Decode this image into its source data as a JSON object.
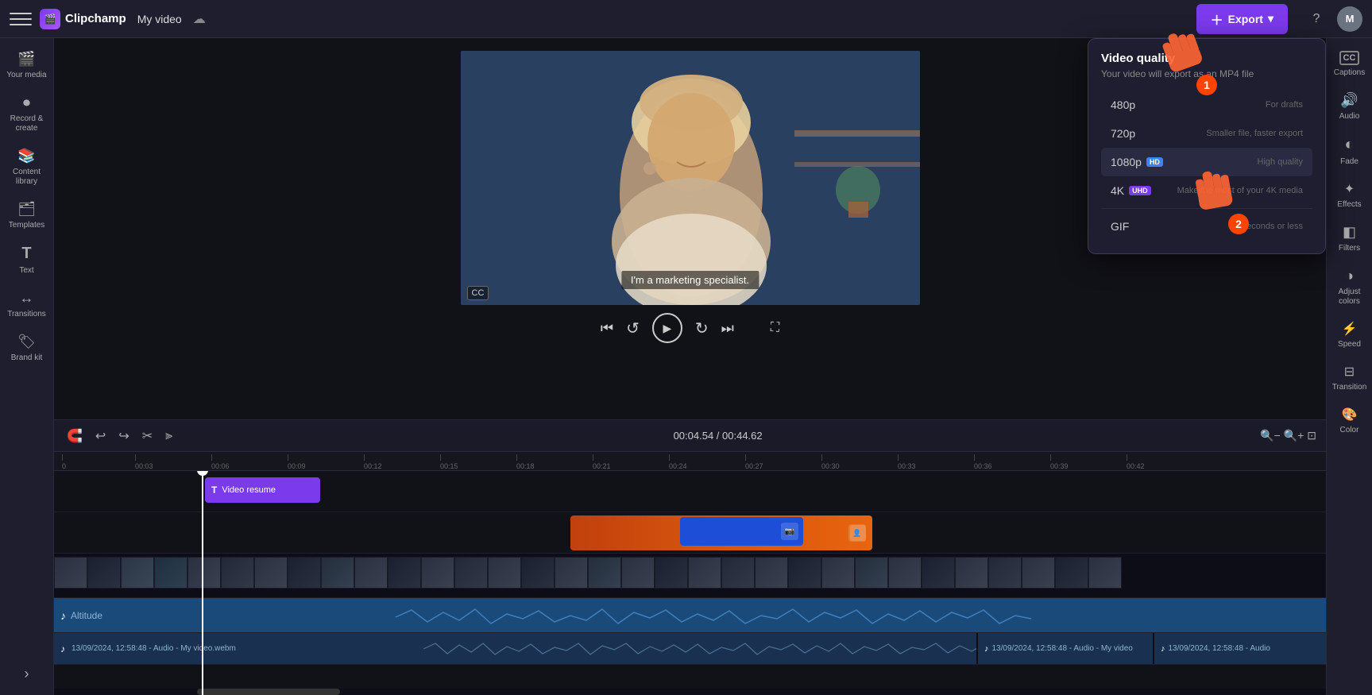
{
  "app": {
    "name": "Clipchamp",
    "title": "My video",
    "logo_char": "C"
  },
  "topbar": {
    "hamburger_label": "Menu",
    "export_label": "Export",
    "export_dropdown_label": "▼",
    "help_label": "?",
    "avatar_initials": "M"
  },
  "left_sidebar": {
    "items": [
      {
        "id": "your-media",
        "icon": "🎬",
        "label": "Your media"
      },
      {
        "id": "record",
        "icon": "⏺",
        "label": "Record & create"
      },
      {
        "id": "content-library",
        "icon": "📚",
        "label": "Content library"
      },
      {
        "id": "templates",
        "icon": "🗂",
        "label": "Templates"
      },
      {
        "id": "text",
        "icon": "T",
        "label": "Text"
      },
      {
        "id": "transitions",
        "icon": "↔",
        "label": "Transitions"
      },
      {
        "id": "brand-kit",
        "icon": "🏷",
        "label": "Brand kit"
      }
    ],
    "expand_arrow": "›"
  },
  "right_sidebar": {
    "items": [
      {
        "id": "captions",
        "icon": "CC",
        "label": "Captions"
      },
      {
        "id": "audio",
        "icon": "🔊",
        "label": "Audio"
      },
      {
        "id": "fade",
        "icon": "◐",
        "label": "Fade"
      },
      {
        "id": "effects",
        "icon": "✦",
        "label": "Effects"
      },
      {
        "id": "filters",
        "icon": "◧",
        "label": "Filters"
      },
      {
        "id": "adjust-colors",
        "icon": "◑",
        "label": "Adjust colors"
      },
      {
        "id": "speed",
        "icon": "⚡",
        "label": "Speed"
      },
      {
        "id": "transition",
        "icon": "⊡",
        "label": "Transition"
      },
      {
        "id": "color",
        "icon": "🎨",
        "label": "Color"
      }
    ]
  },
  "video_preview": {
    "subtitle": "I'm a marketing specialist.",
    "timecode": "00:04.54 / 00:44.62",
    "cc_label": "CC"
  },
  "playback_controls": {
    "skip_back": "⏮",
    "rewind": "↺",
    "play": "▶",
    "forward": "↻",
    "skip_fwd": "⏭",
    "fullscreen": "⛶"
  },
  "timeline": {
    "toolbar": {
      "magnet_icon": "🧲",
      "undo": "↩",
      "redo": "↪",
      "cut": "✂",
      "split": "⫸"
    },
    "timecode": "00:04.54 / 00:44.62",
    "ruler_marks": [
      "0",
      "00:03",
      "00:06",
      "00:09",
      "00:12",
      "00:15",
      "00:18",
      "00:21",
      "00:24",
      "00:27",
      "00:30",
      "00:33",
      "00:36",
      "00:39",
      "00:42"
    ],
    "tracks": [
      {
        "id": "text-track",
        "type": "text",
        "clip_label": "Video resume",
        "clip_icon": "T"
      },
      {
        "id": "video-track",
        "type": "video"
      },
      {
        "id": "music-track",
        "type": "music",
        "label": "Altitude"
      },
      {
        "id": "audio-track1",
        "type": "audio",
        "label": "13/09/2024, 12:58:48 - Audio - My video.webm"
      },
      {
        "id": "audio-track2",
        "type": "audio",
        "label": "13/09/2024, 12:58:48 - Audio - My video"
      },
      {
        "id": "audio-track3",
        "type": "audio",
        "label": "13/09/2024, 12:58:48 - Audio"
      }
    ]
  },
  "export_dropdown": {
    "title": "Video quality",
    "subtitle": "Your video will export as an MP4 file",
    "options": [
      {
        "id": "480p",
        "label": "480p",
        "badge": null,
        "desc": "For drafts"
      },
      {
        "id": "720p",
        "label": "720p",
        "badge": null,
        "desc": "Smaller file, faster export"
      },
      {
        "id": "1080p",
        "label": "1080p",
        "badge": "HD",
        "badge_type": "hd",
        "desc": "High quality"
      },
      {
        "id": "4k",
        "label": "4K",
        "badge": "UHD",
        "badge_type": "uhd",
        "desc": "Make the most of your 4K media"
      },
      {
        "id": "gif",
        "label": "GIF",
        "badge": null,
        "desc": "10 seconds or less"
      }
    ]
  },
  "cursor_hints": [
    {
      "id": "hint1",
      "number": "1"
    },
    {
      "id": "hint2",
      "number": "2"
    }
  ],
  "colors": {
    "accent": "#7c3aed",
    "bg_dark": "#111118",
    "bg_sidebar": "#1e1e2e",
    "text_primary": "#ffffff",
    "text_secondary": "#aaaaaa"
  }
}
